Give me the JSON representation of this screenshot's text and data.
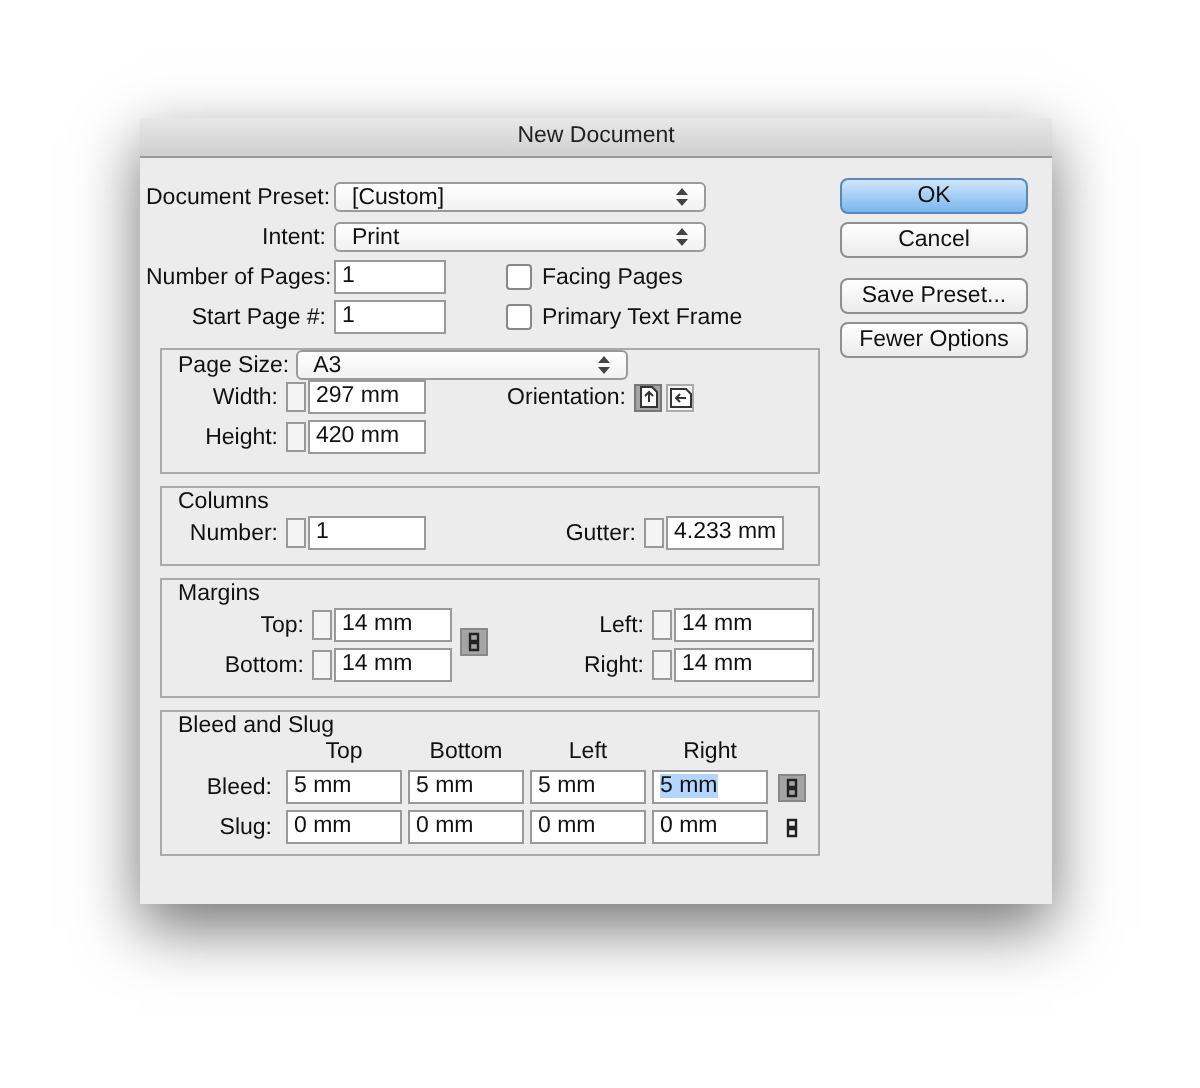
{
  "window": {
    "title": "New Document"
  },
  "preset": {
    "label": "Document Preset:",
    "value": "[Custom]"
  },
  "intent": {
    "label": "Intent:",
    "value": "Print"
  },
  "number_of_pages": {
    "label": "Number of Pages:",
    "value": "1"
  },
  "start_page": {
    "label": "Start Page #:",
    "value": "1"
  },
  "checkboxes": [
    {
      "label": "Facing Pages",
      "checked": false
    },
    {
      "label": "Primary Text Frame",
      "checked": false
    }
  ],
  "buttons": [
    {
      "label": "OK",
      "primary": true
    },
    {
      "label": "Cancel",
      "primary": false
    },
    {
      "label": "Save Preset...",
      "primary": false
    },
    {
      "label": "Fewer Options",
      "primary": false
    }
  ],
  "page_size": {
    "label": "Page Size:",
    "value": "A3",
    "width": {
      "label": "Width:",
      "value": "297 mm"
    },
    "height": {
      "label": "Height:",
      "value": "420 mm"
    },
    "orientation": {
      "label": "Orientation:",
      "options": [
        {
          "kind": "portrait",
          "selected": true
        },
        {
          "kind": "landscape",
          "selected": false
        }
      ]
    }
  },
  "columns": {
    "title": "Columns",
    "number": {
      "label": "Number:",
      "value": "1"
    },
    "gutter": {
      "label": "Gutter:",
      "value": "4.233 mm"
    }
  },
  "margins": {
    "title": "Margins",
    "top": {
      "label": "Top:",
      "value": "14 mm"
    },
    "bottom": {
      "label": "Bottom:",
      "value": "14 mm"
    },
    "left": {
      "label": "Left:",
      "value": "14 mm"
    },
    "right": {
      "label": "Right:",
      "value": "14 mm"
    },
    "linked": true
  },
  "bleed_slug": {
    "title": "Bleed and Slug",
    "headers": [
      "Top",
      "Bottom",
      "Left",
      "Right"
    ],
    "rows": [
      {
        "label": "Bleed:",
        "linked": true,
        "values": [
          {
            "value": "5 mm",
            "selected": false
          },
          {
            "value": "5 mm",
            "selected": false
          },
          {
            "value": "5 mm",
            "selected": false
          },
          {
            "value": "5 mm",
            "selected": true
          }
        ]
      },
      {
        "label": "Slug:",
        "linked": false,
        "values": [
          {
            "value": "0 mm",
            "selected": false
          },
          {
            "value": "0 mm",
            "selected": false
          },
          {
            "value": "0 mm",
            "selected": false
          },
          {
            "value": "0 mm",
            "selected": false
          }
        ]
      }
    ]
  }
}
